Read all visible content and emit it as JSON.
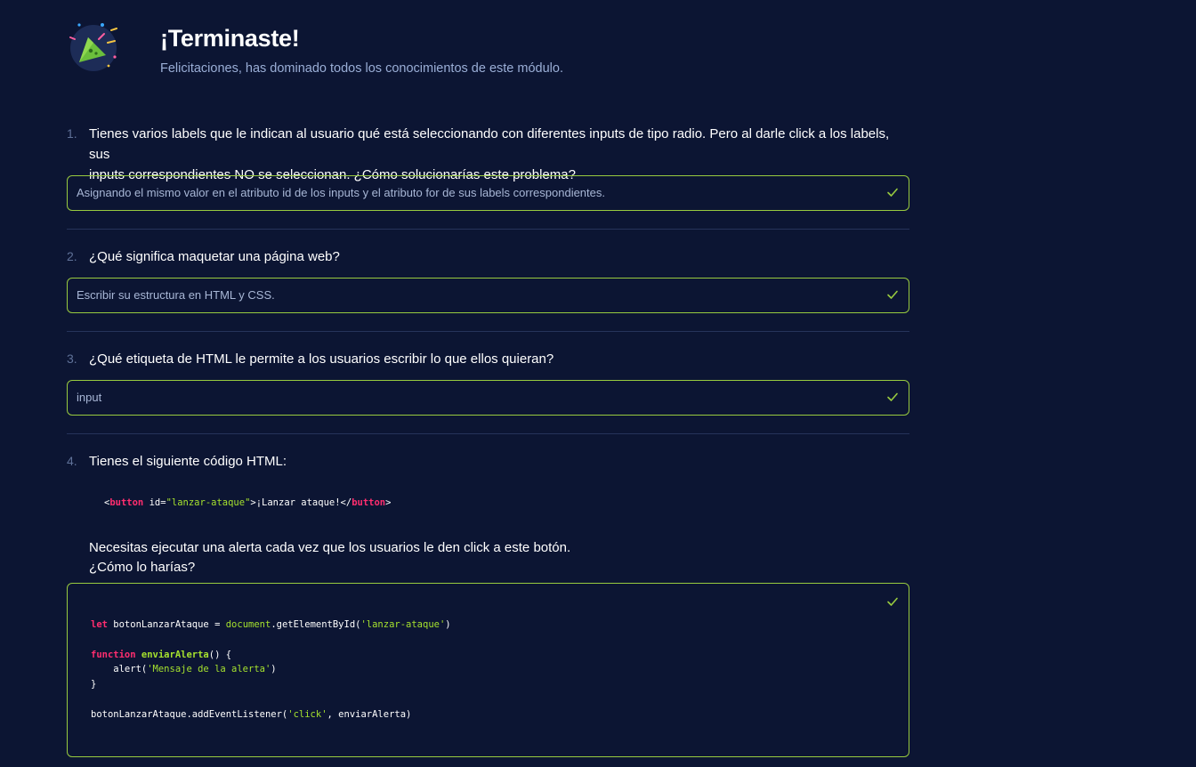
{
  "header": {
    "title": "¡Terminaste!",
    "subtitle": "Felicitaciones, has dominado todos los conocimientos de este módulo.",
    "icon": "party-popper-icon"
  },
  "questions": [
    {
      "number": "1.",
      "line1": "Tienes varios labels que le indican al usuario qué está seleccionando con diferentes inputs de tipo radio. Pero al darle click a los labels, sus",
      "line2": "inputs correspondientes NO se seleccionan. ¿Cómo solucionarías este problema?",
      "answer": "Asignando el mismo valor en el atributo id de los inputs y el atributo for de sus labels correspondientes."
    },
    {
      "number": "2.",
      "line1": "¿Qué significa maquetar una página web?",
      "answer": "Escribir su estructura en HTML y CSS."
    },
    {
      "number": "3.",
      "line1": "¿Qué etiqueta de HTML le permite a los usuarios escribir lo que ellos quieran?",
      "answer": "input"
    },
    {
      "number": "4.",
      "line1": "Tienes el siguiente código HTML:",
      "snippet": {
        "open_lt": "<",
        "tag": "button",
        "attr": " id=",
        "value": "\"lanzar-ataque\"",
        "text": ">¡Lanzar ataque!</",
        "close_tag": "button",
        "close_gt": ">"
      },
      "para1": "Necesitas ejecutar una alerta cada vez que los usuarios le den click a este botón.",
      "para2": "¿Cómo lo harías?",
      "code": {
        "l1_kw": "let",
        "l1_a": " botonLanzarAtaque = ",
        "l1_obj": "document",
        "l1_b": ".getElementById(",
        "l1_str": "'lanzar-ataque'",
        "l1_c": ")",
        "l3_kw": "function",
        "l3_fn": " enviarAlerta",
        "l3_a": "() {",
        "l4_a": "    alert(",
        "l4_str": "'Mensaje de la alerta'",
        "l4_b": ")",
        "l5": "}",
        "l7_a": "botonLanzarAtaque.addEventListener(",
        "l7_str": "'click'",
        "l7_b": ", enviarAlerta)"
      }
    }
  ],
  "colors": {
    "background": "#0c1533",
    "correct_border": "#98ca3f",
    "keyword": "#ff2d6f",
    "string": "#a6e22e"
  }
}
